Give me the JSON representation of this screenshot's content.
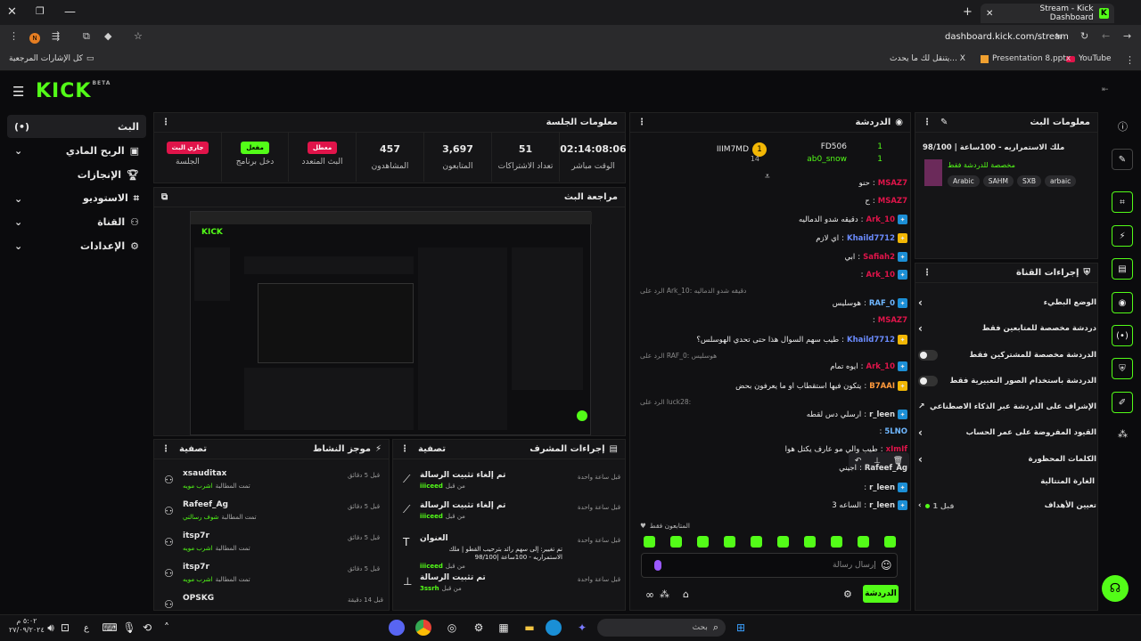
{
  "browser": {
    "tab_title": "Stream - Kick Dashboard",
    "url": "dashboard.kick.com/stream",
    "bookmarks": [
      "YouTube",
      "Presentation 8.pptx",
      "يتنقل لك ما يحدث... X",
      "كل الإشارات المرجعية"
    ]
  },
  "app": {
    "logo": "KICK",
    "beta": "BETA"
  },
  "leftnav": [
    {
      "label": "البث",
      "icon": "broadcast-icon"
    },
    {
      "label": "الربح المادي",
      "icon": "money-icon"
    },
    {
      "label": "الإنجازات",
      "icon": "trophy-icon"
    },
    {
      "label": "الاستوديو",
      "icon": "studio-icon"
    },
    {
      "label": "القناة",
      "icon": "channel-icon"
    },
    {
      "label": "الإعدادات",
      "icon": "gear-icon"
    }
  ],
  "session": {
    "title": "معلومات الجلسة",
    "stats": [
      {
        "value": "02:14:08:06",
        "label": "الوقت مباشر"
      },
      {
        "value": "51",
        "label": "تعداد الاشتراكات"
      },
      {
        "value": "3,697",
        "label": "المتابعون"
      },
      {
        "value": "457",
        "label": "المشاهدون"
      }
    ],
    "pills": [
      {
        "pill": "معطل",
        "label": "البث المتعدد",
        "color": "#e0144a"
      },
      {
        "pill": "مفعل",
        "label": "دخل برنامج",
        "color": "#53fc18"
      },
      {
        "pill": "جاري البث",
        "label": "الجلسة",
        "color": "#e0144a"
      }
    ]
  },
  "preview": {
    "title": "مراجعة البث"
  },
  "activity": {
    "title": "موجز النشاط",
    "filter": "تصفية",
    "items": [
      {
        "name": "xsauditax",
        "sub": "تمت المطالبة",
        "reward": "اشرب مويه",
        "time": "قبل 5 دقائق"
      },
      {
        "name": "Rafeef_Ag",
        "sub": "تمت المطالبة",
        "reward": "شوف رسالتي",
        "time": "قبل 5 دقائق"
      },
      {
        "name": "itsp7r",
        "sub": "تمت المطالبة",
        "reward": "اشرب مويه",
        "time": "قبل 5 دقائق"
      },
      {
        "name": "itsp7r",
        "sub": "تمت المطالبة",
        "reward": "اشرب مويه",
        "time": "قبل 5 دقائق"
      },
      {
        "name": "OPSKG",
        "sub": "",
        "reward": "",
        "time": "قبل 14 دقيقة"
      }
    ]
  },
  "modactions": {
    "title": "إجراءات المشرف",
    "filter": "تصفية",
    "items": [
      {
        "title": "تم إلغاء تثبيت الرسالة",
        "by": "iiiceed",
        "prefix": "من قبل",
        "time": "قبل ساعة واحدة"
      },
      {
        "title": "تم إلغاء تثبيت الرسالة",
        "by": "iiiceed",
        "prefix": "من قبل",
        "time": "قبل ساعة واحدة"
      },
      {
        "title": "العنوان",
        "detail": "تم تغيير: إلى سهم رائد بترحيب القطو | ملك الاستمراريه - 100ساعة |98/100",
        "by": "iiiceed",
        "prefix": "من قبل",
        "time": "قبل ساعة واحدة"
      },
      {
        "title": "تم تثبيت الرسالة",
        "by": "3ssrh",
        "prefix": "من قبل",
        "time": "قبل ساعة واحدة"
      }
    ]
  },
  "chat": {
    "title": "الدردشة",
    "leaders": [
      {
        "name": "IIIM7MD",
        "count": "14",
        "rank": "1"
      },
      {
        "name": "FD506",
        "count": "1"
      },
      {
        "name": "ab0_snow",
        "count": "1"
      }
    ],
    "messages": [
      {
        "user": "MSAZ7",
        "text": "حنو",
        "color": "#e0144a"
      },
      {
        "user": "MSAZ7",
        "text": "ح",
        "color": "#e0144a"
      },
      {
        "user": "Ark_10",
        "text": "دقيقه شدو الدماليه",
        "color": "#e0144a"
      },
      {
        "user": "Khaild7712",
        "text": "اي لازم",
        "color": "#6b8cff"
      },
      {
        "user": "Safiah2",
        "text": "ابي",
        "color": "#e0144a"
      },
      {
        "user": "Ark_10",
        "text": "",
        "color": "#e0144a"
      },
      {
        "user": "RAF_0",
        "text": "هوسليس",
        "color": "#6fb7ff"
      },
      {
        "user": "MSAZ7",
        "text": "",
        "color": "#e0144a"
      },
      {
        "user": "Khaild7712",
        "text": "طيب سهم السوال هذا حتى تحدي الهوسلس؟",
        "color": "#6b8cff"
      },
      {
        "user": "Ark_10",
        "text": "ايوه تمام",
        "color": "#e0144a"
      },
      {
        "user": "B7AAI",
        "text": "يتكون فيها استقطاب او ما يعرفون بحض",
        "color": "#ff9a3c"
      },
      {
        "user": "r_leen",
        "text": "ارسلي دس لقطه",
        "color": "#ddd"
      },
      {
        "user": "5LNO",
        "text": "",
        "color": "#6fb7ff"
      },
      {
        "user": "xImIf",
        "text": "طيب والي مو عارف يكتل هوا",
        "color": "#e0144a"
      },
      {
        "user": "Rafeef_Ag",
        "text": "اجيني",
        "color": "#ddd"
      },
      {
        "user": "r_leen",
        "text": "",
        "color": "#ddd"
      },
      {
        "user": "r_leen",
        "text": "الساعه 3",
        "color": "#ddd"
      }
    ],
    "replies": [
      "الرد على Ark_10: دقيقه شدو الدماليه",
      "الرد على RAF_0: هوسليس",
      "الرد على luck28:"
    ],
    "followers_only": "المتابعون فقط",
    "placeholder": "إرسال رسالة",
    "send": "الدردشة"
  },
  "streaminfo": {
    "title": "معلومات البث",
    "stream_title": "ملك الاستمراريه - 100ساعة | 98/100",
    "category": "مخصصة للدردشة فقط",
    "tags": [
      "Arabic",
      "SAHM",
      "SXB",
      "arbaic"
    ]
  },
  "channelactions": {
    "title": "إجراءات القناة",
    "rows": [
      {
        "label": "الوضع البطيء",
        "kind": "chevron"
      },
      {
        "label": "دردشة مخصصة للمتابعين فقط",
        "kind": "chevron"
      },
      {
        "label": "الدردشة مخصصة للمشتركين فقط",
        "kind": "toggle"
      },
      {
        "label": "الدردشة باستخدام الصور التعبيرية فقط",
        "kind": "toggle"
      },
      {
        "label": "الإشراف على الدردشة عبر الذكاء الاصطناعي",
        "kind": "link"
      },
      {
        "label": "القيود المفروضة على عمر الحساب",
        "kind": "chevron"
      },
      {
        "label": "الكلمات المحظورة",
        "kind": "chevron"
      }
    ],
    "raid": "الغارة المتتالية",
    "goal": "تعيين الأهداف",
    "goal_status": "قبل 1"
  },
  "taskbar": {
    "time": "٥:٠٢ م",
    "date": "٢٧/٠٩/٢٠٢٤",
    "search": "بحث"
  }
}
